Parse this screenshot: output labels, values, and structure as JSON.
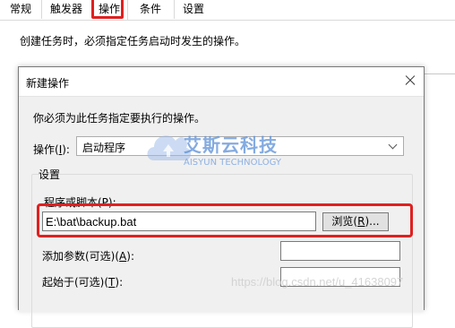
{
  "parent_window": {
    "tabs": [
      "常规",
      "触发器",
      "操作",
      "条件",
      "设置"
    ],
    "active_tab": "操作",
    "description": "创建任务时，必须指定任务启动时发生的操作。"
  },
  "dialog": {
    "title": "新建操作",
    "instruction": "你必须为此任务指定要执行的操作。",
    "action_label": "操作(",
    "action_label_key": "I",
    "action_label_end": "):",
    "action_value": "启动程序",
    "settings_label": "设置",
    "program_label": "程序或脚本(P):",
    "program_value": "E:\\bat\\backup.bat",
    "browse_label_pre": "浏览(",
    "browse_label_key": "R",
    "browse_label_post": ")...",
    "args_label_pre": "添加参数(可选)(",
    "args_label_key": "A",
    "args_label_post": "):",
    "start_label_pre": "起始于(可选)(",
    "start_label_key": "T",
    "start_label_post": "):"
  },
  "watermark": {
    "text_cn": "艾斯云科技",
    "text_en": "AISYUN TECHNOLOGY",
    "csdn": "https://blog.csdn.net/u_41638097"
  },
  "colors": {
    "highlight": "#e02020",
    "watermark": "#5b8fd6"
  }
}
